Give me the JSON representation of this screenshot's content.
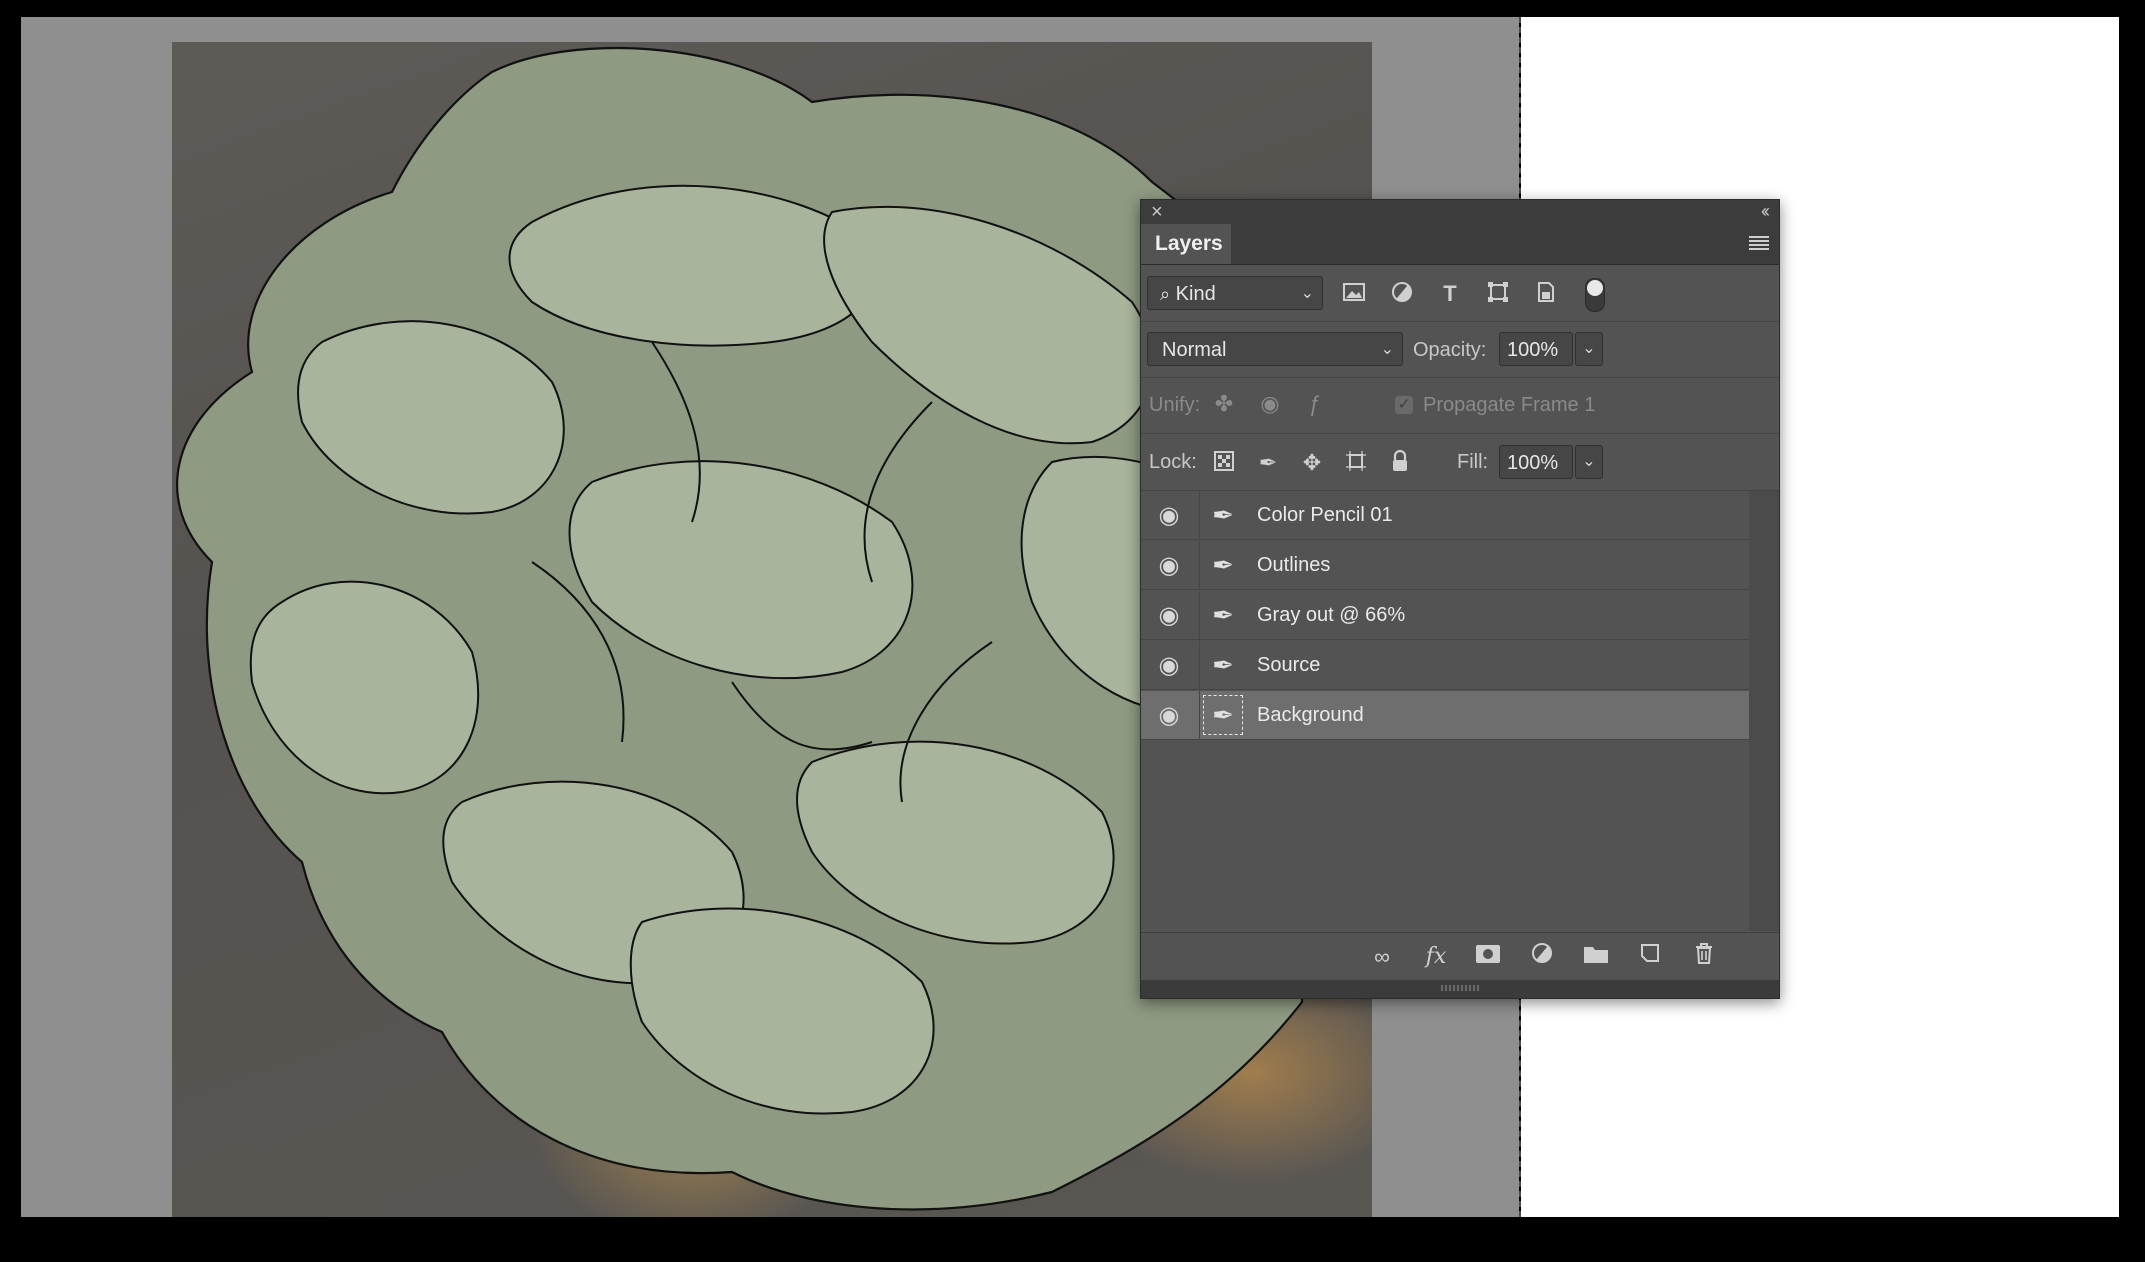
{
  "panel": {
    "title": "Layers",
    "close_glyph": "×",
    "collapse_glyph": "‹‹"
  },
  "filter": {
    "kind_label": "Kind",
    "kind_icon": "search-icon",
    "icons": [
      "pixel-layer-filter-icon",
      "adjustment-layer-filter-icon",
      "type-layer-filter-icon",
      "shape-layer-filter-icon",
      "smart-object-filter-icon"
    ]
  },
  "blend": {
    "mode": "Normal",
    "opacity_label": "Opacity:",
    "opacity_value": "100%"
  },
  "unify": {
    "label": "Unify:",
    "propagate_label": "Propagate Frame 1",
    "propagate_checked": true
  },
  "lock": {
    "label": "Lock:",
    "fill_label": "Fill:",
    "fill_value": "100%"
  },
  "layers": [
    {
      "name": "Color Pencil 01",
      "visible": true,
      "selected": false
    },
    {
      "name": "Outlines",
      "visible": true,
      "selected": false
    },
    {
      "name": "Gray out @ 66%",
      "visible": true,
      "selected": false
    },
    {
      "name": "Source",
      "visible": true,
      "selected": false
    },
    {
      "name": "Background",
      "visible": true,
      "selected": true
    }
  ],
  "bottom_bar": {
    "fx_label": "fx"
  }
}
